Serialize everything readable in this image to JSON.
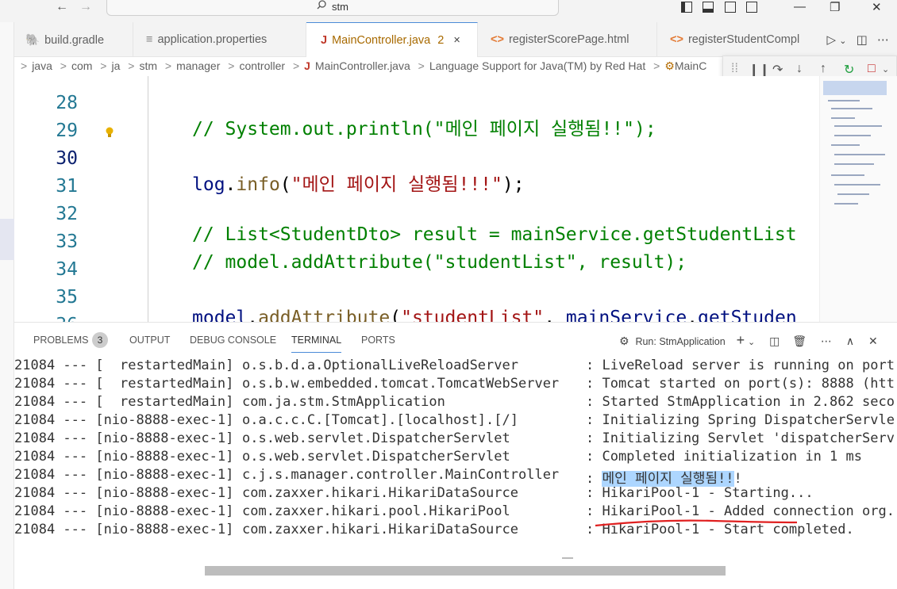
{
  "titlebar": {
    "search_text": "stm",
    "back_icon": "←",
    "forward_icon": "→",
    "minimize": "—",
    "restore": "❐",
    "close": "✕"
  },
  "tabs": [
    {
      "label": "build.gradle",
      "icon": "gradle-icon"
    },
    {
      "label": "application.properties",
      "icon": "settings-file-icon"
    },
    {
      "label": "MainController.java",
      "badge": "2",
      "close": "×",
      "icon": "java-icon",
      "active": true
    },
    {
      "label": "registerScorePage.html",
      "icon": "html-icon"
    },
    {
      "label": "registerStudentCompl",
      "icon": "html-icon"
    }
  ],
  "breadcrumb": [
    "java",
    "com",
    "ja",
    "stm",
    "manager",
    "controller",
    "MainController.java",
    "Language Support for Java(TM) by Red Hat",
    "MainC"
  ],
  "editor": {
    "lines": [
      {
        "n": "28",
        "text": "// System.out.println(\"메인 페이지 실행됨!!\");"
      },
      {
        "n": "29",
        "text": ""
      },
      {
        "n": "30",
        "text": "log.info(\"메인 페이지 실행됨!!!\");"
      },
      {
        "n": "31",
        "text": ""
      },
      {
        "n": "32",
        "text": "// List<StudentDto> result = mainService.getStudentList"
      },
      {
        "n": "33",
        "text": "// model.addAttribute(\"studentList\", result);"
      },
      {
        "n": "34",
        "text": ""
      },
      {
        "n": "35",
        "text": "model.addAttribute(\"studentList\", mainService.getStuden"
      },
      {
        "n": "36",
        "text": ""
      }
    ]
  },
  "panel": {
    "tabs": [
      "PROBLEMS",
      "OUTPUT",
      "DEBUG CONSOLE",
      "TERMINAL",
      "PORTS"
    ],
    "problems_count": "3",
    "active_tab": "TERMINAL",
    "run_label": "Run: StmApplication"
  },
  "terminal": [
    {
      "a": "21084 --- [  restartedMain]",
      "b": "o.s.b.d.a.OptionalLiveReloadServer",
      "c": ": LiveReload server is running on port"
    },
    {
      "a": "21084 --- [  restartedMain]",
      "b": "o.s.b.w.embedded.tomcat.TomcatWebServer",
      "c": ": Tomcat started on port(s): 8888 (htt"
    },
    {
      "a": "21084 --- [  restartedMain]",
      "b": "com.ja.stm.StmApplication",
      "c": ": Started StmApplication in 2.862 seco"
    },
    {
      "a": "21084 --- [nio-8888-exec-1]",
      "b": "o.a.c.c.C.[Tomcat].[localhost].[/]",
      "c": ": Initializing Spring DispatcherServle"
    },
    {
      "a": "21084 --- [nio-8888-exec-1]",
      "b": "o.s.web.servlet.DispatcherServlet",
      "c": ": Initializing Servlet 'dispatcherServ"
    },
    {
      "a": "21084 --- [nio-8888-exec-1]",
      "b": "o.s.web.servlet.DispatcherServlet",
      "c": ": Completed initialization in 1 ms"
    },
    {
      "a": "21084 --- [nio-8888-exec-1]",
      "b": "c.j.s.manager.controller.MainController",
      "c_prefix": ": ",
      "c_sel": "메인 페이지 실행됨!!",
      "c_rest": "!"
    },
    {
      "a": "21084 --- [nio-8888-exec-1]",
      "b": "com.zaxxer.hikari.HikariDataSource",
      "c": ": HikariPool-1 - Starting..."
    },
    {
      "a": "21084 --- [nio-8888-exec-1]",
      "b": "com.zaxxer.hikari.pool.HikariPool",
      "c": ": HikariPool-1 - Added connection org."
    },
    {
      "a": "21084 --- [nio-8888-exec-1]",
      "b": "com.zaxxer.hikari.HikariDataSource",
      "c": ": HikariPool-1 - Start completed."
    }
  ]
}
